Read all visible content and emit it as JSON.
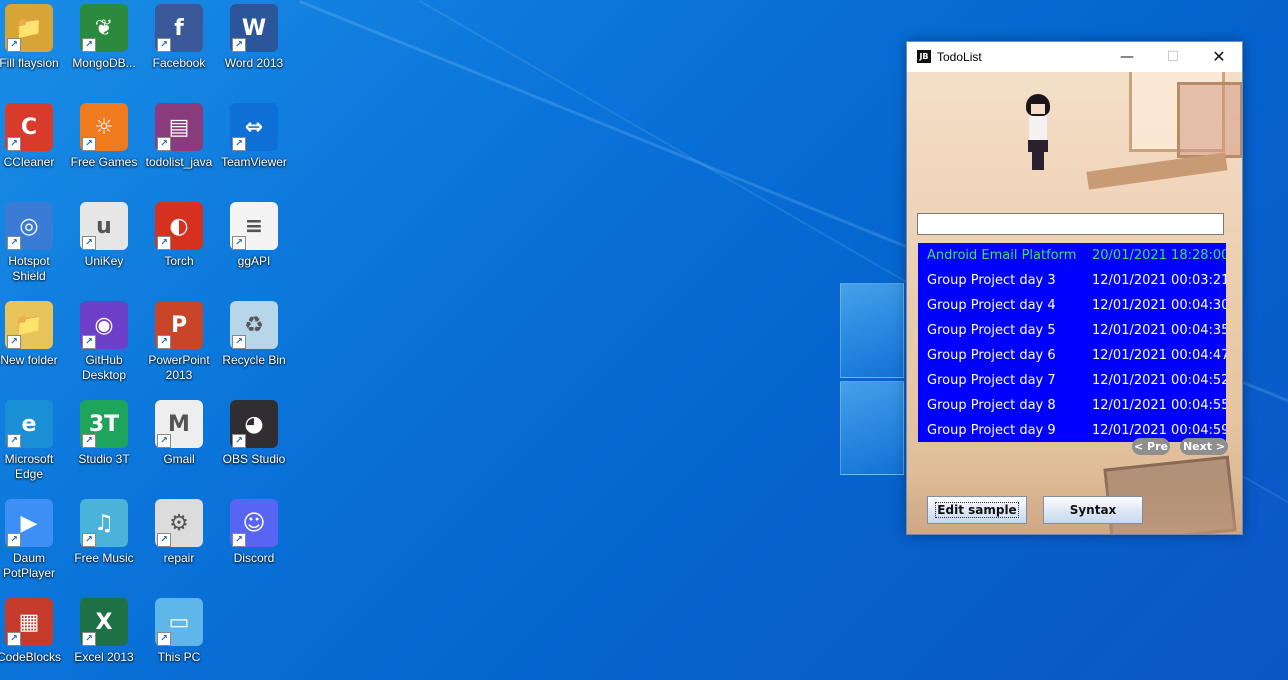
{
  "desktop": {
    "icons": [
      {
        "label": "Fill flaysion",
        "icon": "user-folder-icon",
        "color": "#d6a437"
      },
      {
        "label": "CCleaner",
        "icon": "ccleaner-icon",
        "color": "#d93b2b"
      },
      {
        "label": "Hotspot Shield",
        "icon": "hotspot-shield-icon",
        "color": "#3a7bd5"
      },
      {
        "label": "New folder",
        "icon": "folder-icon",
        "color": "#e8c35a"
      },
      {
        "label": "Microsoft Edge",
        "icon": "edge-icon",
        "color": "#1b8fd6"
      },
      {
        "label": "Daum PotPlayer",
        "icon": "potplayer-icon",
        "color": "#3d8ef5"
      },
      {
        "label": "CodeBlocks",
        "icon": "codeblocks-icon",
        "color": "#c43b2b"
      },
      {
        "label": "MongoDB...",
        "icon": "mongodb-icon",
        "color": "#2b8a3e"
      },
      {
        "label": "Free Games",
        "icon": "free-games-icon",
        "color": "#f07a1e"
      },
      {
        "label": "UniKey",
        "icon": "unikey-icon",
        "color": "#e6e6e6"
      },
      {
        "label": "GitHub Desktop",
        "icon": "github-desktop-icon",
        "color": "#6e40c9"
      },
      {
        "label": "Studio 3T",
        "icon": "studio3t-icon",
        "color": "#1fa55b"
      },
      {
        "label": "Free Music",
        "icon": "free-music-icon",
        "color": "#4bb3d9"
      },
      {
        "label": "Excel 2013",
        "icon": "excel-icon",
        "color": "#1e7145"
      },
      {
        "label": "Facebook",
        "icon": "facebook-icon",
        "color": "#3b5998"
      },
      {
        "label": "todolist_java",
        "icon": "winrar-archive-icon",
        "color": "#8a3b7c"
      },
      {
        "label": "Torch",
        "icon": "torch-icon",
        "color": "#d6301f"
      },
      {
        "label": "PowerPoint 2013",
        "icon": "powerpoint-icon",
        "color": "#c9452a"
      },
      {
        "label": "Gmail",
        "icon": "gmail-icon",
        "color": "#eeeeee"
      },
      {
        "label": "repair",
        "icon": "settings-file-icon",
        "color": "#dcdcdc"
      },
      {
        "label": "This PC",
        "icon": "this-pc-icon",
        "color": "#5fb6e8"
      },
      {
        "label": "Word 2013",
        "icon": "word-icon",
        "color": "#2b579a"
      },
      {
        "label": "TeamViewer",
        "icon": "teamviewer-icon",
        "color": "#0e6fd6"
      },
      {
        "label": "ggAPI",
        "icon": "text-file-icon",
        "color": "#f4f4f4"
      },
      {
        "label": "Recycle Bin",
        "icon": "recycle-bin-icon",
        "color": "#b8d6ea"
      },
      {
        "label": "OBS Studio",
        "icon": "obs-studio-icon",
        "color": "#302e31"
      },
      {
        "label": "Discord",
        "icon": "discord-icon",
        "color": "#5865f2"
      }
    ]
  },
  "window": {
    "title": "TodoList",
    "app_icon_text": "JB",
    "minimize_glyph": "—",
    "maximize_glyph": "☐",
    "close_glyph": "✕",
    "input_value": "",
    "tasks": [
      {
        "name": "Android Email Platform",
        "date": "20/01/2021 18:28:00",
        "highlight": true
      },
      {
        "name": "Group Project day 3",
        "date": "12/01/2021 00:03:21",
        "highlight": false
      },
      {
        "name": "Group Project day 4",
        "date": "12/01/2021 00:04:30",
        "highlight": false
      },
      {
        "name": "Group Project day 5",
        "date": "12/01/2021 00:04:35",
        "highlight": false
      },
      {
        "name": "Group Project day 6",
        "date": "12/01/2021 00:04:47",
        "highlight": false
      },
      {
        "name": "Group Project day 7",
        "date": "12/01/2021 00:04:52",
        "highlight": false
      },
      {
        "name": "Group Project day 8",
        "date": "12/01/2021 00:04:55",
        "highlight": false
      },
      {
        "name": "Group Project day 9",
        "date": "12/01/2021 00:04:59",
        "highlight": false
      }
    ],
    "prev_label": "< Pre",
    "next_label": "Next >",
    "edit_label": "Edit sample",
    "syntax_label": "Syntax",
    "list_bg_color": "#0000ff",
    "highlight_color": "#3fe067"
  }
}
